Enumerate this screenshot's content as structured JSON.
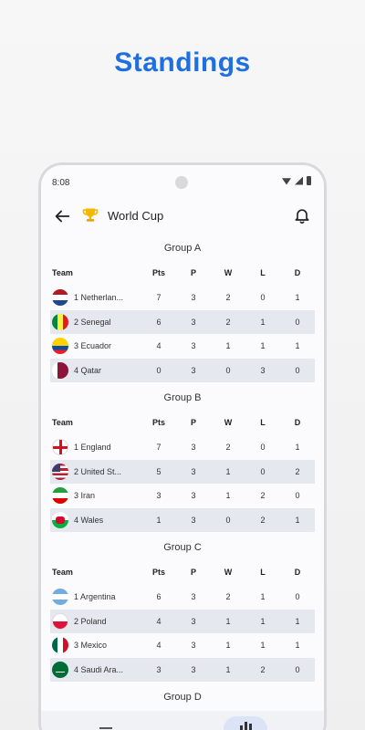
{
  "hero_title": "Standings",
  "status_bar": {
    "time": "8:08"
  },
  "app_bar": {
    "title": "World Cup"
  },
  "columns": {
    "team": "Team",
    "pts": "Pts",
    "p": "P",
    "w": "W",
    "l": "L",
    "d": "D"
  },
  "groups": [
    {
      "name": "Group A",
      "rows": [
        {
          "team": "1 Netherlan...",
          "flag": "netherlands-flag-icon",
          "pts": "7",
          "p": "3",
          "w": "2",
          "l": "0",
          "d": "1"
        },
        {
          "team": "2 Senegal",
          "flag": "senegal-flag-icon",
          "pts": "6",
          "p": "3",
          "w": "2",
          "l": "1",
          "d": "0"
        },
        {
          "team": "3 Ecuador",
          "flag": "ecuador-flag-icon",
          "pts": "4",
          "p": "3",
          "w": "1",
          "l": "1",
          "d": "1"
        },
        {
          "team": "4 Qatar",
          "flag": "qatar-flag-icon",
          "pts": "0",
          "p": "3",
          "w": "0",
          "l": "3",
          "d": "0"
        }
      ]
    },
    {
      "name": "Group B",
      "rows": [
        {
          "team": "1 England",
          "flag": "england-flag-icon",
          "pts": "7",
          "p": "3",
          "w": "2",
          "l": "0",
          "d": "1"
        },
        {
          "team": "2 United St...",
          "flag": "usa-flag-icon",
          "pts": "5",
          "p": "3",
          "w": "1",
          "l": "0",
          "d": "2"
        },
        {
          "team": "3 Iran",
          "flag": "iran-flag-icon",
          "pts": "3",
          "p": "3",
          "w": "1",
          "l": "2",
          "d": "0"
        },
        {
          "team": "4 Wales",
          "flag": "wales-flag-icon",
          "pts": "1",
          "p": "3",
          "w": "0",
          "l": "2",
          "d": "1"
        }
      ]
    },
    {
      "name": "Group C",
      "rows": [
        {
          "team": "1 Argentina",
          "flag": "argentina-flag-icon",
          "pts": "6",
          "p": "3",
          "w": "2",
          "l": "1",
          "d": "0"
        },
        {
          "team": "2 Poland",
          "flag": "poland-flag-icon",
          "pts": "4",
          "p": "3",
          "w": "1",
          "l": "1",
          "d": "1"
        },
        {
          "team": "3 Mexico",
          "flag": "mexico-flag-icon",
          "pts": "4",
          "p": "3",
          "w": "1",
          "l": "1",
          "d": "1"
        },
        {
          "team": "4 Saudi Ara...",
          "flag": "saudi-arabia-flag-icon",
          "pts": "3",
          "p": "3",
          "w": "1",
          "l": "2",
          "d": "0"
        }
      ]
    },
    {
      "name": "Group D",
      "rows": []
    }
  ],
  "colors": {
    "accent": "#1e6fe0",
    "row_alt": "#e6e8f0",
    "nav_pill": "#dbe3f7"
  }
}
